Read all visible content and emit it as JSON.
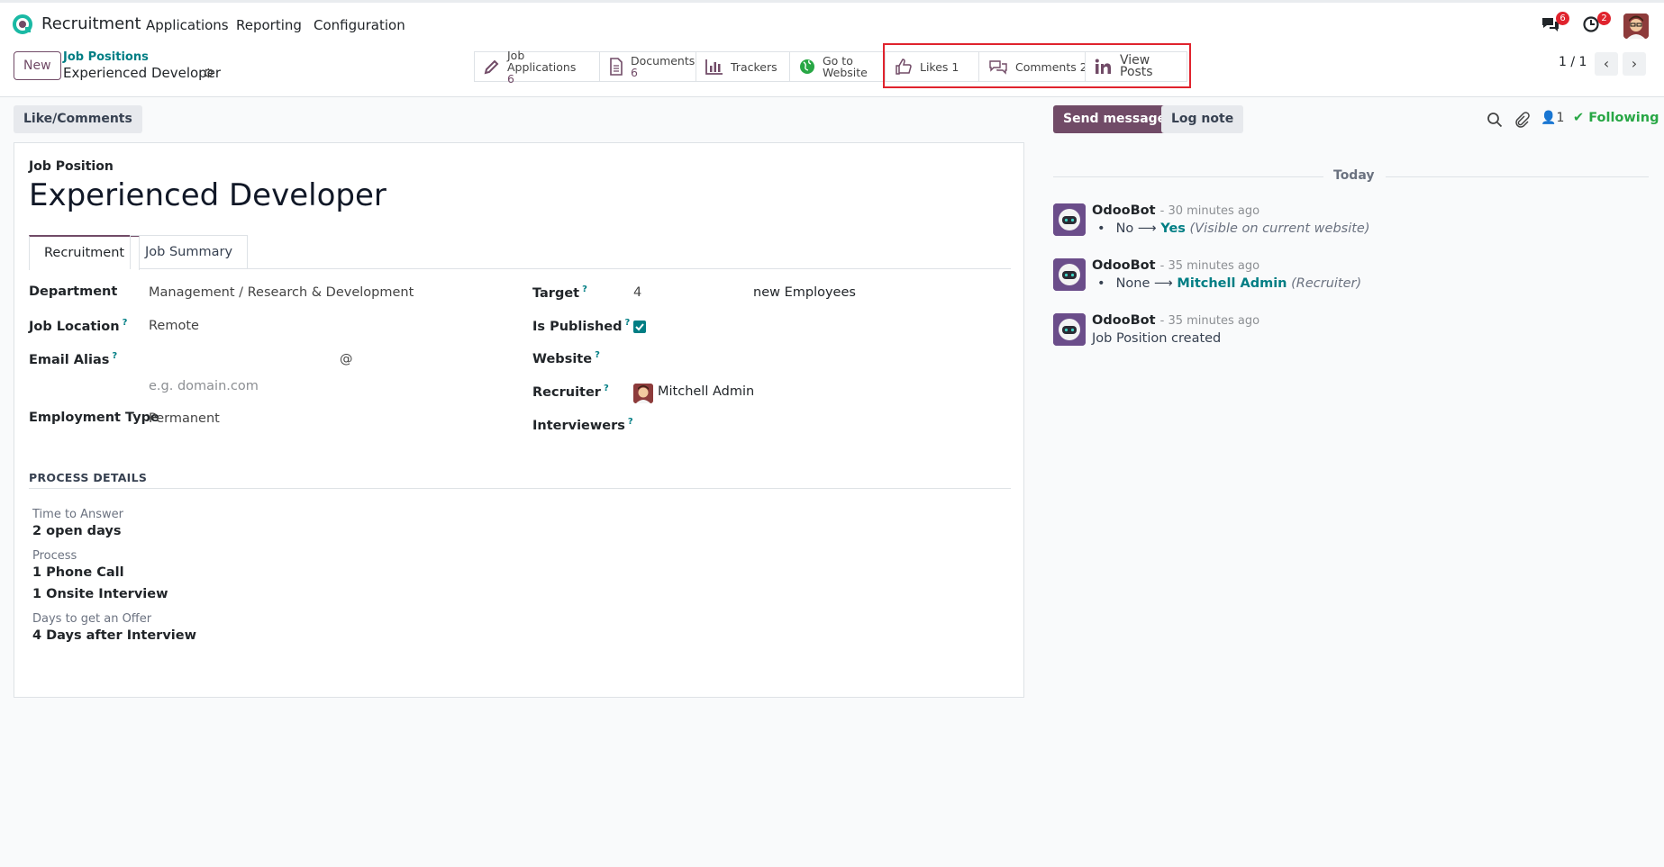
{
  "app": {
    "name": "Recruitment"
  },
  "menu": [
    "Applications",
    "Reporting",
    "Configuration"
  ],
  "top_icons": {
    "messages_badge": "6",
    "activities_badge": "2"
  },
  "control": {
    "new_label": "New",
    "breadcrumb_parent": "Job Positions",
    "breadcrumb_current": "Experienced Developer",
    "pager": "1 / 1"
  },
  "smart_buttons": {
    "job_applications": {
      "label": "Job Applications",
      "count": "6"
    },
    "documents": {
      "label": "Documents",
      "count": "6"
    },
    "trackers": {
      "label": "Trackers"
    },
    "go_to_website": {
      "line1": "Go to",
      "line2": "Website"
    },
    "likes": {
      "label": "Likes",
      "count": "1"
    },
    "comments": {
      "label": "Comments",
      "count": "2"
    },
    "view_posts": {
      "label": "View Posts"
    }
  },
  "form": {
    "like_comments_button": "Like/Comments",
    "record_label": "Job Position",
    "title": "Experienced Developer",
    "tabs": [
      "Recruitment",
      "Job Summary"
    ],
    "fields": {
      "department": {
        "label": "Department",
        "value": "Management / Research & Development"
      },
      "job_location": {
        "label": "Job Location",
        "value": "Remote"
      },
      "email_alias": {
        "label": "Email Alias",
        "at": "@",
        "placeholder": "e.g. domain.com"
      },
      "employment_type": {
        "label": "Employment Type",
        "value": "Permanent"
      },
      "target": {
        "label": "Target",
        "value": "4",
        "suffix": "new Employees"
      },
      "is_published": {
        "label": "Is Published",
        "checked": true
      },
      "website": {
        "label": "Website"
      },
      "recruiter": {
        "label": "Recruiter",
        "value": "Mitchell Admin"
      },
      "interviewers": {
        "label": "Interviewers"
      },
      "help_mark": "?"
    },
    "process": {
      "heading": "PROCESS DETAILS",
      "time_to_answer_label": "Time to Answer",
      "time_to_answer_value": "2 open days",
      "process_label": "Process",
      "process_values": [
        "1 Phone Call",
        "1 Onsite Interview"
      ],
      "offer_label": "Days to get an Offer",
      "offer_value": "4 Days after Interview"
    }
  },
  "chatter": {
    "send_message": "Send message",
    "log_note": "Log note",
    "followers_count": "1",
    "following": "Following",
    "date_separator": "Today",
    "messages": [
      {
        "author": "OdooBot",
        "time": "- 30 minutes ago",
        "old": "No",
        "new": "Yes",
        "note": "(Visible on current website)"
      },
      {
        "author": "OdooBot",
        "time": "- 35 minutes ago",
        "old": "None",
        "new": "Mitchell Admin",
        "note": "(Recruiter)"
      },
      {
        "author": "OdooBot",
        "time": "- 35 minutes ago",
        "text": "Job Position created"
      }
    ]
  },
  "colors": {
    "brand": "#714b67",
    "teal": "#017e84",
    "highlight": "#e0232d",
    "following": "#28a745"
  }
}
